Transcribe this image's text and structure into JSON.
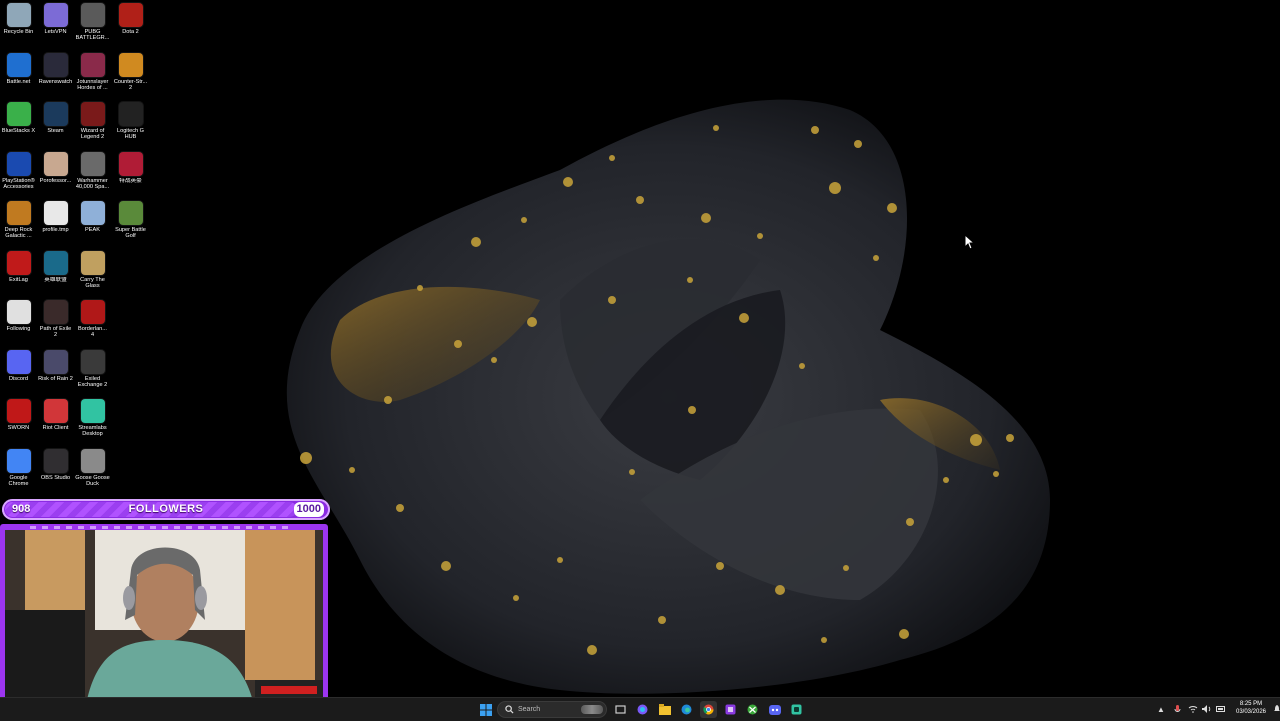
{
  "desktop": {
    "icons": [
      {
        "label": "Recycle Bin",
        "icon": "recycle-bin-icon",
        "color": "#8fa7b8"
      },
      {
        "label": "LetsVPN",
        "icon": "vpn-icon",
        "color": "#7c6bd6"
      },
      {
        "label": "PUBG\nBATTLEGR...",
        "icon": "pubg-icon",
        "color": "#5a5a5a"
      },
      {
        "label": "Dota 2",
        "icon": "dota-icon",
        "color": "#b02018"
      },
      {
        "label": "Battle.net",
        "icon": "battlenet-icon",
        "color": "#1f6fd0"
      },
      {
        "label": "Ravenswatch",
        "icon": "ravenswatch-icon",
        "color": "#2a2a3a"
      },
      {
        "label": "Jotunnslayer\nHordes of ...",
        "icon": "jotunnslayer-icon",
        "color": "#8a2a4a"
      },
      {
        "label": "Counter-Str...\n2",
        "icon": "counter-strike-icon",
        "color": "#d08a20"
      },
      {
        "label": "BlueStacks X",
        "icon": "bluestacks-icon",
        "color": "#3ab04a"
      },
      {
        "label": "Steam",
        "icon": "steam-icon",
        "color": "#1b3a5c"
      },
      {
        "label": "Wizard of\nLegend 2",
        "icon": "wizard-of-legend-icon",
        "color": "#7a1a1a"
      },
      {
        "label": "Logitech G\nHUB",
        "icon": "logitech-icon",
        "color": "#222222"
      },
      {
        "label": "PlayStation®\nAccessories",
        "icon": "playstation-icon",
        "color": "#1a4ab0"
      },
      {
        "label": "Porofessor...",
        "icon": "porofessor-icon",
        "color": "#c8a890"
      },
      {
        "label": "Warhammer\n40,000 Spa...",
        "icon": "warhammer-icon",
        "color": "#6a6a6a"
      },
      {
        "label": "特战英豪",
        "icon": "valorant-icon",
        "color": "#b01c36"
      },
      {
        "label": "Deep Rock\nGalactic ...",
        "icon": "deep-rock-icon",
        "color": "#c07a20"
      },
      {
        "label": "profile.tmp",
        "icon": "file-icon",
        "color": "#e8e8e8"
      },
      {
        "label": "PEAK",
        "icon": "peak-icon",
        "color": "#8fb0d8"
      },
      {
        "label": "Super Battle\nGolf",
        "icon": "golf-icon",
        "color": "#5a8a3a"
      },
      {
        "label": "ExitLag",
        "icon": "exitlag-icon",
        "color": "#c01a1a"
      },
      {
        "label": "英雄联盟",
        "icon": "league-icon",
        "color": "#1a6a8a"
      },
      {
        "label": "Carry The\nGlass",
        "icon": "carry-glass-icon",
        "color": "#c0a060"
      },
      {
        "label": "",
        "icon": "",
        "color": ""
      },
      {
        "label": "Following",
        "icon": "chrome-following-icon",
        "color": "#e0e0e0"
      },
      {
        "label": "Path of Exile\n2",
        "icon": "path-of-exile-icon",
        "color": "#3a2a2a"
      },
      {
        "label": "Borderlan...\n4",
        "icon": "borderlands-icon",
        "color": "#b01818"
      },
      {
        "label": "",
        "icon": "",
        "color": ""
      },
      {
        "label": "Discord",
        "icon": "discord-icon",
        "color": "#5865f2"
      },
      {
        "label": "Risk of Rain 2",
        "icon": "risk-of-rain-icon",
        "color": "#4a4a6a"
      },
      {
        "label": "Exiled\nExchange 2",
        "icon": "exiled-exchange-icon",
        "color": "#3a3a3a"
      },
      {
        "label": "",
        "icon": "",
        "color": ""
      },
      {
        "label": "SWORN",
        "icon": "sworn-icon",
        "color": "#c01818"
      },
      {
        "label": "Riot Client",
        "icon": "riot-client-icon",
        "color": "#d13639"
      },
      {
        "label": "Streamlabs\nDesktop",
        "icon": "streamlabs-icon",
        "color": "#31c3a2"
      },
      {
        "label": "",
        "icon": "",
        "color": ""
      },
      {
        "label": "Google\nChrome",
        "icon": "chrome-icon",
        "color": "#4285f4"
      },
      {
        "label": "OBS Studio",
        "icon": "obs-icon",
        "color": "#302e31"
      },
      {
        "label": "Goose Goose\nDuck",
        "icon": "goose-duck-icon",
        "color": "#8a8a8a"
      }
    ]
  },
  "overlay": {
    "followers_current": "908",
    "followers_label": "FOLLOWERS",
    "followers_goal": "1000",
    "progress": 0.908,
    "accent": "#8a2be2"
  },
  "taskbar": {
    "search_placeholder": "Search",
    "apps": [
      {
        "name": "start-icon"
      },
      {
        "name": "task-view-icon"
      },
      {
        "name": "copilot-icon"
      },
      {
        "name": "file-explorer-icon"
      },
      {
        "name": "edge-icon"
      },
      {
        "name": "chrome-icon"
      },
      {
        "name": "app-purple-icon"
      },
      {
        "name": "xbox-icon"
      },
      {
        "name": "discord-icon"
      },
      {
        "name": "streamlabs-icon"
      }
    ],
    "clock_time": "8:25 PM",
    "clock_date": "03/03/2026"
  }
}
